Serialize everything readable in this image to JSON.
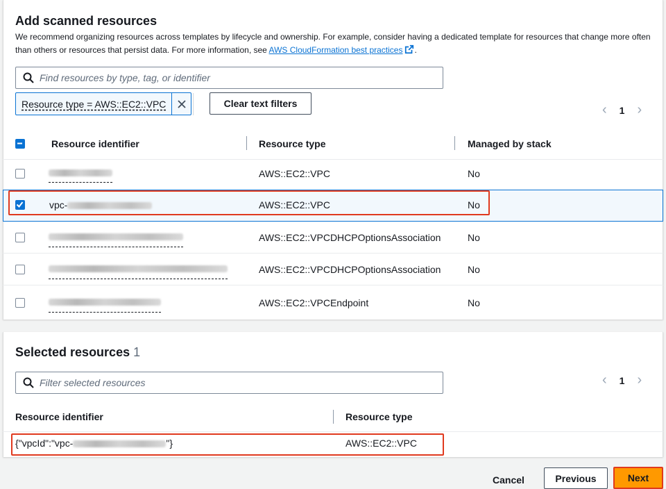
{
  "scan": {
    "title": "Add scanned resources",
    "description": "We recommend organizing resources across templates by lifecycle and ownership. For example, consider having a dedicated template for resources that change more often than others or resources that persist data. For more information, see",
    "link_text": "AWS CloudFormation best practices",
    "description_end": ".",
    "search_placeholder": "Find resources by type, tag, or identifier",
    "filter_token": "Resource type = AWS::EC2::VPC",
    "clear_button": "Clear text filters",
    "page": "1",
    "columns": [
      "Resource identifier",
      "Resource type",
      "Managed by stack"
    ],
    "rows": [
      {
        "identifier_prefix": "",
        "type": "AWS::EC2::VPC",
        "managed": "No",
        "checked": false
      },
      {
        "identifier_prefix": "vpc-",
        "type": "AWS::EC2::VPC",
        "managed": "No",
        "checked": true
      },
      {
        "identifier_prefix": "",
        "type": "AWS::EC2::VPCDHCPOptionsAssociation",
        "managed": "No",
        "checked": false
      },
      {
        "identifier_prefix": "",
        "type": "AWS::EC2::VPCDHCPOptionsAssociation",
        "managed": "No",
        "checked": false
      },
      {
        "identifier_prefix": "",
        "type": "AWS::EC2::VPCEndpoint",
        "managed": "No",
        "checked": false
      }
    ]
  },
  "selected": {
    "title": "Selected resources",
    "count": "1",
    "search_placeholder": "Filter selected resources",
    "page": "1",
    "columns": [
      "Resource identifier",
      "Resource type"
    ],
    "row": {
      "identifier_prefix": "{\"vpcId\":\"vpc-",
      "identifier_suffix": "\"}",
      "type": "AWS::EC2::VPC"
    }
  },
  "footer": {
    "cancel": "Cancel",
    "previous": "Previous",
    "next": "Next"
  },
  "colors": {
    "accent": "#0972d3",
    "primary_button": "#ff9900",
    "highlight_box": "#e0391e"
  }
}
